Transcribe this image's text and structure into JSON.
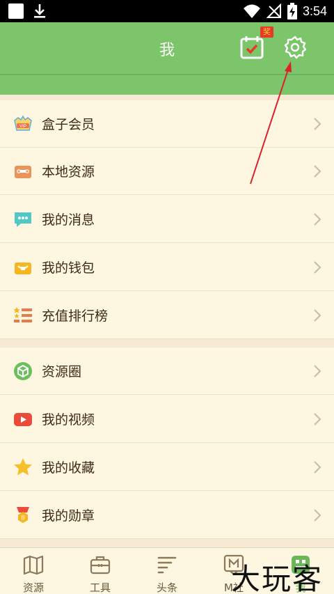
{
  "status_bar": {
    "time": "3:54"
  },
  "header": {
    "title": "我",
    "reward_badge": "奖"
  },
  "menu_group_1": [
    {
      "label": "盒子会员",
      "icon": "vip-icon"
    },
    {
      "label": "本地资源",
      "icon": "toolbox-icon"
    },
    {
      "label": "我的消息",
      "icon": "chat-bubble-icon"
    },
    {
      "label": "我的钱包",
      "icon": "wallet-icon"
    },
    {
      "label": "充值排行榜",
      "icon": "ranking-list-icon"
    }
  ],
  "menu_group_2": [
    {
      "label": "资源圈",
      "icon": "cube-icon"
    },
    {
      "label": "我的视频",
      "icon": "play-icon"
    },
    {
      "label": "我的收藏",
      "icon": "star-icon"
    },
    {
      "label": "我的勋章",
      "icon": "medal-icon"
    }
  ],
  "bottom_nav": [
    {
      "label": "资源",
      "icon": "map-icon"
    },
    {
      "label": "工具",
      "icon": "toolbox-icon"
    },
    {
      "label": "头条",
      "icon": "headlines-icon"
    },
    {
      "label": "M社",
      "icon": "community-icon"
    },
    {
      "label": "我",
      "icon": "profile-icon",
      "active": true
    }
  ],
  "watermark": "大玩客",
  "colors": {
    "header": "#7cc56a",
    "background": "#fcf6e1",
    "accent_red": "#e53a25"
  }
}
